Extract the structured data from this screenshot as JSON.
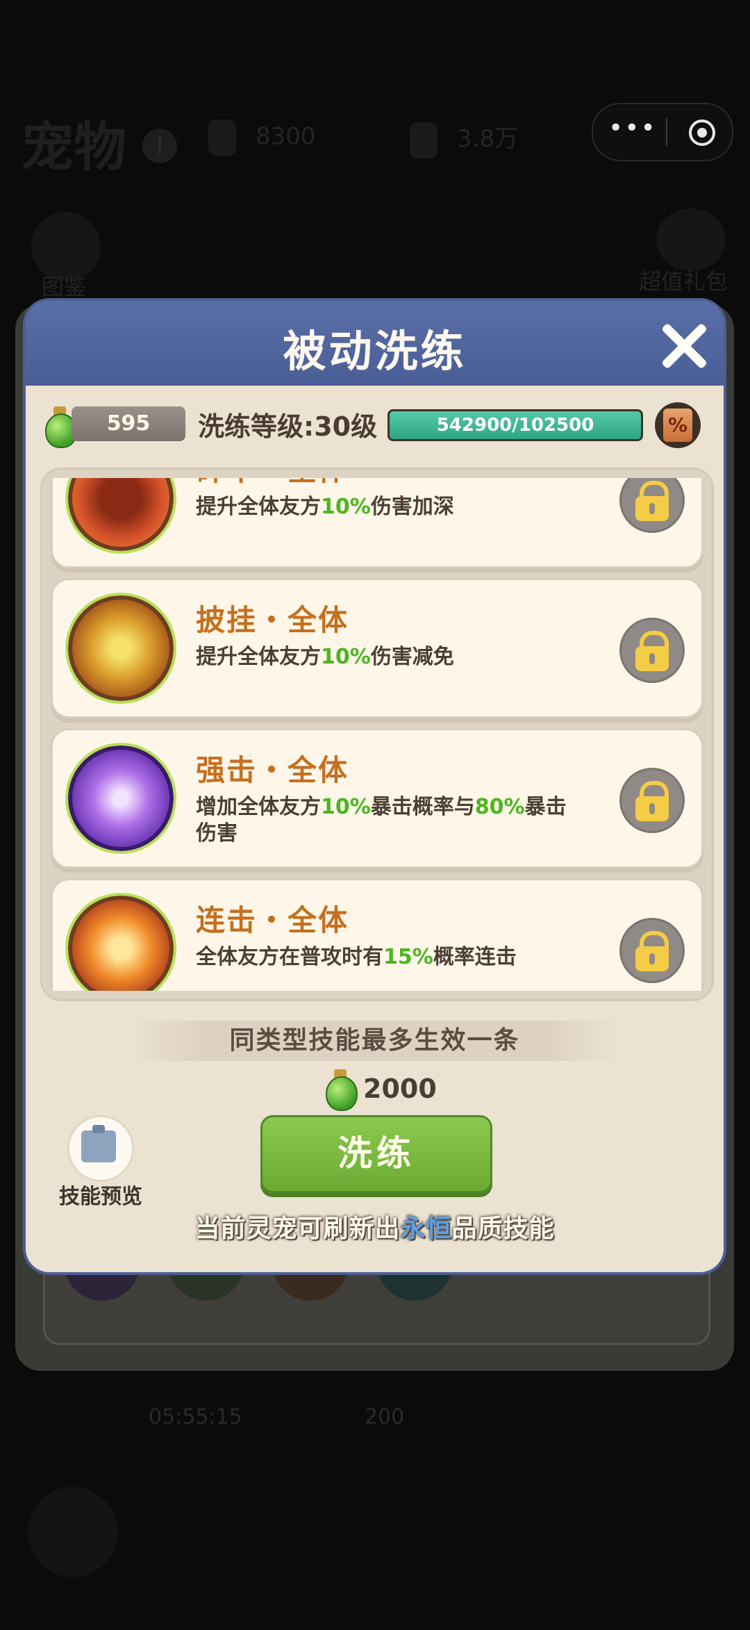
{
  "background": {
    "title": "宠物",
    "badge": "!",
    "resource_1": "8300",
    "resource_2": "3.8万",
    "left_label": "图鉴",
    "right_label": "超值礼包",
    "timer": "05:55:15",
    "cost": "200"
  },
  "miniprogram": {
    "more_icon": "•••",
    "target_icon": "record-target-icon"
  },
  "modal": {
    "title": "被动洗练",
    "energy": "595",
    "level_label": "洗练等级:30级",
    "exp_text": "542900/102500",
    "exp_fill": 1.0,
    "scroll_icon": "%"
  },
  "skills": [
    {
      "name": "碎甲・全体",
      "desc_pre": "提升全体友方",
      "hl1": "10%",
      "desc_mid": "伤害加深",
      "hl2": "",
      "desc_post": "",
      "icon": "shield-break-icon"
    },
    {
      "name": "披挂・全体",
      "desc_pre": "提升全体友方",
      "hl1": "10%",
      "desc_mid": "伤害减免",
      "hl2": "",
      "desc_post": "",
      "icon": "armor-icon"
    },
    {
      "name": "强击・全体",
      "desc_pre": "增加全体友方",
      "hl1": "10%",
      "desc_mid": "暴击概率与",
      "hl2": "80%",
      "desc_post": "暴击伤害",
      "icon": "critical-strike-icon"
    },
    {
      "name": "连击・全体",
      "desc_pre": "全体友方在普攻时有",
      "hl1": "15%",
      "desc_mid": "概率连击",
      "hl2": "",
      "desc_post": "",
      "icon": "combo-icon"
    }
  ],
  "note": "同类型技能最多生效一条",
  "cost": "2000",
  "preview_label": "技能预览",
  "refine_label": "洗练",
  "footer": {
    "pre": "当前灵宠可刷新出",
    "quality": "永恒",
    "post": "品质技能"
  },
  "colors": {
    "header": "#4a5e96",
    "skill_name": "#c56f1e",
    "highlight": "#4cb51f",
    "button": "#7ab843",
    "eternal": "#5aa0e8"
  }
}
